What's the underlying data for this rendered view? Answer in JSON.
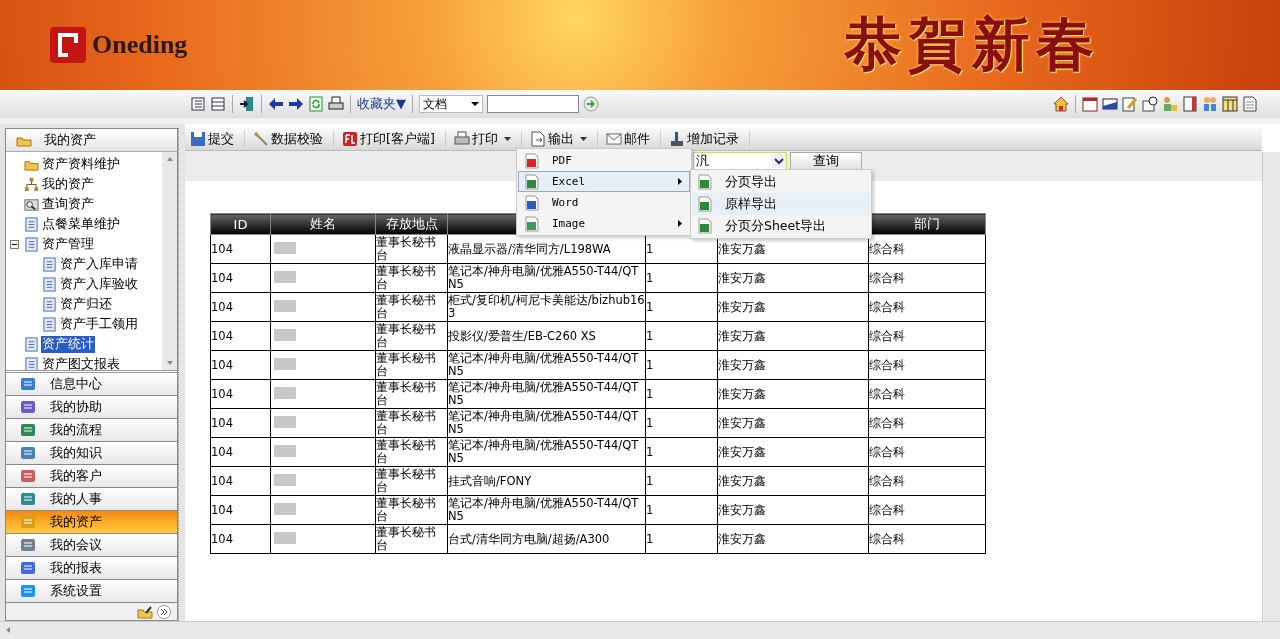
{
  "banner": {
    "logo": "Oneding",
    "greeting": "恭賀新春"
  },
  "toolbar": {
    "favorites": "收藏夹▼",
    "scope": "文档"
  },
  "sidebar": {
    "header": "我的资产",
    "tree": [
      {
        "label": "资产资料维护",
        "kind": "folder",
        "selected": false
      },
      {
        "label": "我的资产",
        "kind": "org",
        "selected": false
      },
      {
        "label": "查询资产",
        "kind": "search",
        "selected": false
      },
      {
        "label": "点餐菜单维护",
        "kind": "page",
        "selected": false
      },
      {
        "label": "资产管理",
        "kind": "page",
        "selected": false,
        "expanded": true,
        "children": [
          {
            "label": "资产入库申请",
            "kind": "page",
            "selected": false
          },
          {
            "label": "资产入库验收",
            "kind": "page",
            "selected": false
          },
          {
            "label": "资产归还",
            "kind": "page",
            "selected": false
          },
          {
            "label": "资产手工领用",
            "kind": "page",
            "selected": false
          }
        ]
      },
      {
        "label": "资产统计",
        "kind": "page",
        "selected": true
      },
      {
        "label": "资产图文报表",
        "kind": "page",
        "selected": false
      }
    ],
    "modules": [
      {
        "label": "信息中心",
        "selected": false
      },
      {
        "label": "我的协助",
        "selected": false
      },
      {
        "label": "我的流程",
        "selected": false
      },
      {
        "label": "我的知识",
        "selected": false
      },
      {
        "label": "我的客户",
        "selected": false
      },
      {
        "label": "我的人事",
        "selected": false
      },
      {
        "label": "我的资产",
        "selected": true
      },
      {
        "label": "我的会议",
        "selected": false
      },
      {
        "label": "我的报表",
        "selected": false
      },
      {
        "label": "系统设置",
        "selected": false
      }
    ]
  },
  "actions": [
    {
      "label": "提交",
      "kind": "save",
      "dropdown": false
    },
    {
      "label": "数据校验",
      "kind": "wand",
      "dropdown": false
    },
    {
      "label": "打印[客户端]",
      "kind": "fl",
      "dropdown": false
    },
    {
      "label": "打印",
      "kind": "printer",
      "dropdown": true
    },
    {
      "label": "输出",
      "kind": "export",
      "dropdown": true
    },
    {
      "label": "邮件",
      "kind": "mail",
      "dropdown": false
    },
    {
      "label": "增加记录",
      "kind": "add",
      "dropdown": false
    }
  ],
  "filter": {
    "value": "汎",
    "button": "查询"
  },
  "table": {
    "header": {
      "id": "ID",
      "name": "姓名",
      "location": "存放地点",
      "department": "部门"
    },
    "rows": [
      {
        "id": "104",
        "location": "董事长秘书台",
        "column_4": "液晶显示器/清华同方/L198WA",
        "column_5": "1",
        "column_6": "淮安万鑫",
        "department": "综合科"
      },
      {
        "id": "104",
        "location": "董事长秘书台",
        "column_4": "笔记本/神舟电脑/优雅A550-T44/QTN5",
        "column_5": "1",
        "column_6": "淮安万鑫",
        "department": "综合科"
      },
      {
        "id": "104",
        "location": "董事长秘书台",
        "column_4": "柜式/复印机/柯尼卡美能达/bizhub163",
        "column_5": "1",
        "column_6": "淮安万鑫",
        "department": "综合科"
      },
      {
        "id": "104",
        "location": "董事长秘书台",
        "column_4": "投影仪/爱普生/EB-C260 XS",
        "column_5": "1",
        "column_6": "淮安万鑫",
        "department": "综合科"
      },
      {
        "id": "104",
        "location": "董事长秘书台",
        "column_4": "笔记本/神舟电脑/优雅A550-T44/QTN5",
        "column_5": "1",
        "column_6": "淮安万鑫",
        "department": "综合科"
      },
      {
        "id": "104",
        "location": "董事长秘书台",
        "column_4": "笔记本/神舟电脑/优雅A550-T44/QTN5",
        "column_5": "1",
        "column_6": "淮安万鑫",
        "department": "综合科"
      },
      {
        "id": "104",
        "location": "董事长秘书台",
        "column_4": "笔记本/神舟电脑/优雅A550-T44/QTN5",
        "column_5": "1",
        "column_6": "淮安万鑫",
        "department": "综合科"
      },
      {
        "id": "104",
        "location": "董事长秘书台",
        "column_4": "笔记本/神舟电脑/优雅A550-T44/QTN5",
        "column_5": "1",
        "column_6": "淮安万鑫",
        "department": "综合科"
      },
      {
        "id": "104",
        "location": "董事长秘书台",
        "column_4": "挂式音响/FONY",
        "column_5": "1",
        "column_6": "淮安万鑫",
        "department": "综合科"
      },
      {
        "id": "104",
        "location": "董事长秘书台",
        "column_4": "笔记本/神舟电脑/优雅A550-T44/QTN5",
        "column_5": "1",
        "column_6": "淮安万鑫",
        "department": "综合科"
      },
      {
        "id": "104",
        "location": "董事长秘书台",
        "column_4": "台式/清华同方电脑/超扬/A300",
        "column_5": "1",
        "column_6": "淮安万鑫",
        "department": "综合科"
      }
    ]
  },
  "export_menu": {
    "items": [
      {
        "label": "PDF",
        "kind": "pdf",
        "selected": false,
        "submenu": false
      },
      {
        "label": "Excel",
        "kind": "excel",
        "selected": true,
        "submenu": true
      },
      {
        "label": "Word",
        "kind": "word",
        "selected": false,
        "submenu": false
      },
      {
        "label": "Image",
        "kind": "image",
        "selected": false,
        "submenu": true
      }
    ],
    "submenu": [
      {
        "label": "分页导出",
        "selected": false
      },
      {
        "label": "原样导出",
        "selected": true
      },
      {
        "label": "分页分Sheet导出",
        "selected": false
      }
    ]
  }
}
